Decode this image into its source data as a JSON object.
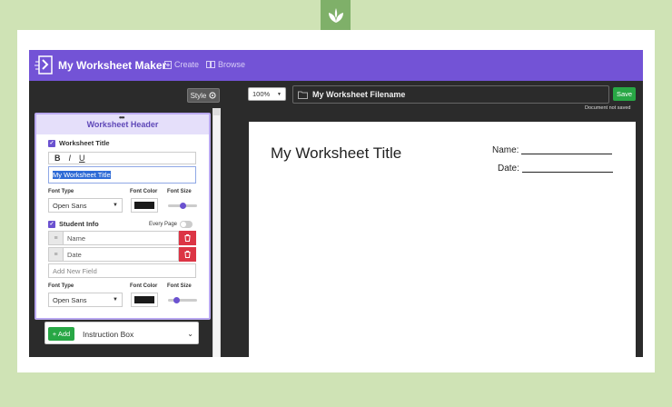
{
  "app": {
    "brand": "My Worksheet Maker",
    "nav": {
      "create": "Create",
      "browse": "Browse"
    },
    "colors": {
      "nav": "#7353d6",
      "accent": "#6b52d0",
      "save": "#28a745",
      "delete": "#dc3545"
    }
  },
  "left": {
    "style_button": "Style",
    "panel_title": "Worksheet Header",
    "worksheet_title_label": "Worksheet Title",
    "format": {
      "bold": "B",
      "italic": "I",
      "underline": "U"
    },
    "title_value": "My Worksheet Title",
    "font_type_label": "Font Type",
    "font_color_label": "Font Color",
    "font_size_label": "Font Size",
    "font_type_value": "Open Sans",
    "student_info_label": "Student Info",
    "every_page_label": "Every Page",
    "fields": [
      {
        "value": "Name"
      },
      {
        "value": "Date"
      }
    ],
    "new_field_placeholder": "Add New Field",
    "font_type_value_2": "Open Sans",
    "add_button": "+ Add",
    "add_select": "Instruction Box"
  },
  "right": {
    "zoom": "100%",
    "filename": "My Worksheet Filename",
    "save": "Save",
    "status": "Document not saved",
    "worksheet": {
      "title": "My Worksheet Title",
      "name_label": "Name:",
      "date_label": "Date:"
    }
  }
}
